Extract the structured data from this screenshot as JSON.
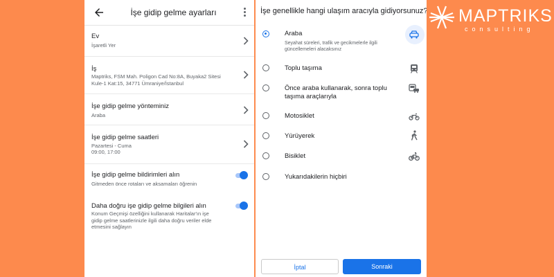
{
  "settings": {
    "title": "İşe gidip gelme ayarları",
    "items": [
      {
        "title": "Ev",
        "subtitle": "İşaretli Yer"
      },
      {
        "title": "İş",
        "subtitle": "Maptriks, FSM Mah. Poligon Cad No:8A, Buyaka2 Sitesi Kule-1 Kat:15, 34771 Ümraniye/İstanbul"
      },
      {
        "title": "İşe gidip gelme yönteminiz",
        "subtitle": "Araba"
      },
      {
        "title": "İşe gidip gelme saatleri",
        "subtitle": "Pazartesi - Cuma",
        "subtitle2": "09:00, 17:00"
      },
      {
        "title": "İşe gidip gelme bildirimleri alın",
        "subtitle": "Gitmeden önce rotaları ve aksamaları öğrenin",
        "toggle": true
      },
      {
        "title": "Daha doğru işe gidip gelme bilgileri alın",
        "subtitle": "Konum Geçmişi özelliğini kullanarak Haritalar'ın işe gidip gelme saatlerinizle ilgili daha doğru veriler elde etmesini sağlayın",
        "toggle": true
      }
    ]
  },
  "transport": {
    "question": "İşe genellikle hangi ulaşım aracıyla gidiyorsunuz?",
    "selected_index": 0,
    "options": [
      {
        "label": "Araba",
        "sub": "Seyahat süreleri, trafik ve gecikmelerle ilgili güncellemeleri alacaksınız",
        "icon": "car-icon"
      },
      {
        "label": "Toplu taşıma",
        "icon": "train-icon"
      },
      {
        "label": "Önce araba kullanarak, sonra toplu taşıma araçlarıyla",
        "icon": "car-transit-icon"
      },
      {
        "label": "Motosiklet",
        "icon": "motorcycle-icon"
      },
      {
        "label": "Yürüyerek",
        "icon": "walking-icon"
      },
      {
        "label": "Bisiklet",
        "icon": "bicycle-icon"
      },
      {
        "label": "Yukarıdakilerin hiçbiri"
      }
    ],
    "cancel_label": "İptal",
    "next_label": "Sonraki"
  },
  "logo": {
    "main": "MAPTRIKS",
    "sub": "consulting"
  },
  "colors": {
    "background": "#fd8a4d",
    "accent": "#1a73e8",
    "panel": "#ffffff"
  }
}
